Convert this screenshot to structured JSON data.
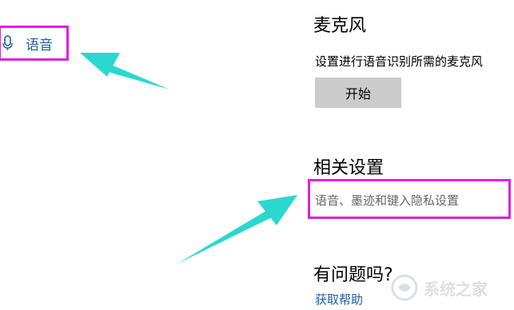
{
  "nav": {
    "cutoff_label": "",
    "speech_label": "语音"
  },
  "microphone": {
    "title": "麦克风",
    "description": "设置进行语音识别所需的麦克风",
    "start_label": "开始"
  },
  "related": {
    "title": "相关设置",
    "link_label": "语音、墨迹和键入隐私设置"
  },
  "help": {
    "title": "有问题吗?",
    "link_label": "获取帮助"
  },
  "watermark": {
    "text": "系统之家"
  },
  "colors": {
    "accent": "#1b5fa8",
    "highlight": "#e020e0",
    "arrow": "#2ad8d0",
    "button_bg": "#cccccc"
  }
}
